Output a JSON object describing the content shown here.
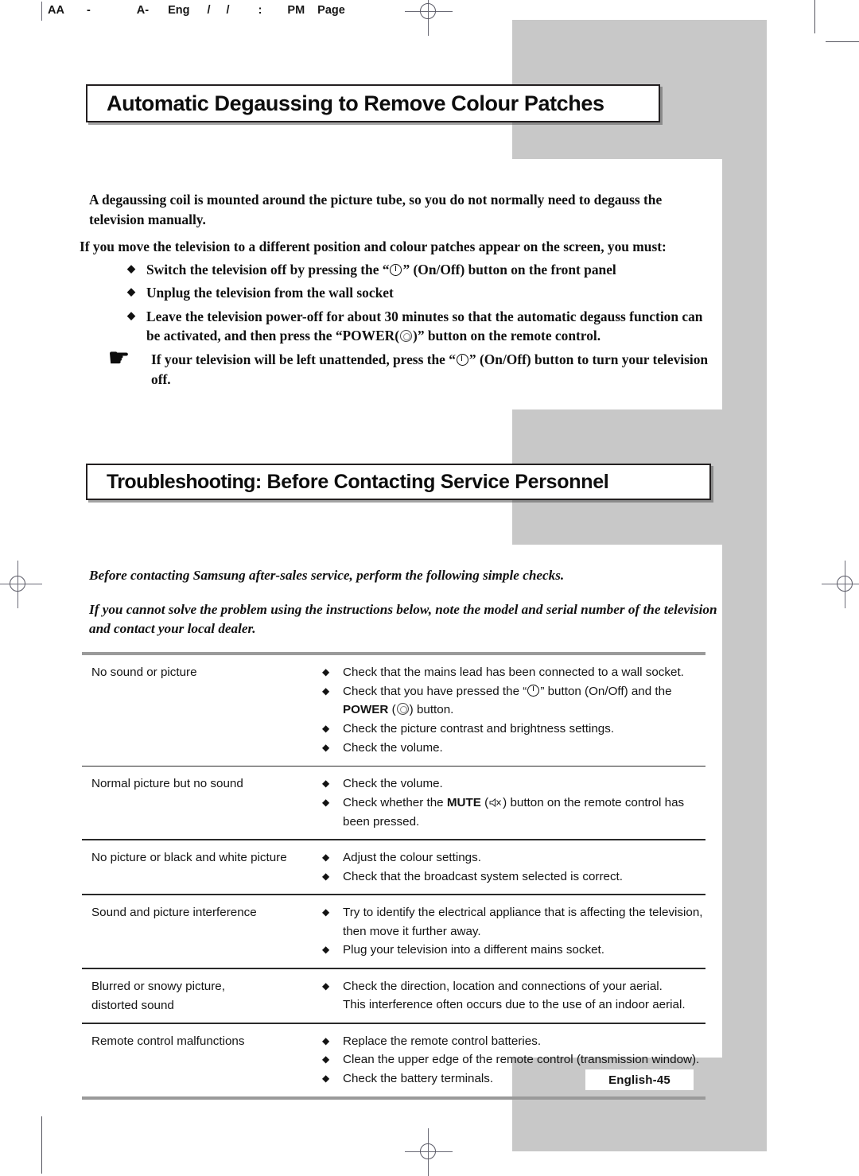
{
  "slug": {
    "segments": [
      "AA",
      "-",
      "A-",
      "Eng",
      "/",
      "/",
      ":",
      "PM",
      "Page"
    ]
  },
  "section_one": {
    "title": "Automatic Degaussing to Remove Colour Patches",
    "intro_paragraph": "A degaussing coil is mounted around the picture tube, so you do not normally need to degauss the television manually.",
    "lead_in": "If you move the television to a different position and colour patches appear on the screen, you must:",
    "bullet_glyph": "◆",
    "bullets": [
      {
        "pre": "Switch the television off by pressing the “",
        "icon": "power-onoff-icon",
        "post": "” (On/Off) button on the front panel"
      },
      {
        "pre": "Unplug the television from the wall socket",
        "icon": "",
        "post": ""
      },
      {
        "pre": "Leave the television power-off for about 30 minutes so that the automatic degauss function can be activated, and then press the “POWER(",
        "icon": "power-ring-icon",
        "post": ")” button on the remote control."
      }
    ],
    "note": {
      "icon": "pointing-hand-icon",
      "glyph": "☛",
      "pre": "If your television will be left unattended, press the “",
      "inline_icon": "power-onoff-icon",
      "post": "” (On/Off) button to turn your television off."
    }
  },
  "section_two": {
    "title_strong": "Troubleshooting:",
    "title_rest": "Before Contacting Service Personnel",
    "intro_italic_1": "Before contacting Samsung after-sales service, perform the following simple checks.",
    "intro_italic_2": "If you cannot solve the problem using the instructions below, note the model and serial number of the television and contact your local dealer.",
    "bullet_glyph": "◆",
    "rows": [
      {
        "cause": [
          "No sound or picture"
        ],
        "fixes": [
          {
            "text": "Check that the mains lead has been connected to a wall socket.",
            "lines": []
          },
          {
            "text": "Check that you have pressed the “",
            "icon_mid": "power-onoff-icon",
            "text2": "” button (On/Off) and the",
            "lines": [
              "POWER ( ) button."
            ],
            "second_line_bold_word": "POWER",
            "second_line_icon": "power-ring-icon",
            "second_line_tail": ") button."
          },
          {
            "text": "Check the picture contrast and brightness settings.",
            "lines": []
          },
          {
            "text": "Check the volume.",
            "lines": []
          }
        ]
      },
      {
        "cause": [
          "Normal picture but no sound"
        ],
        "fixes": [
          {
            "text": "Check the volume.",
            "lines": []
          },
          {
            "text": "Check whether the ",
            "bold_word": "MUTE",
            "icon_mid": "mute-icon",
            "text2": ") button on the remote control has",
            "lines": [
              "been pressed."
            ]
          }
        ]
      },
      {
        "cause": [
          "No picture or black and white picture"
        ],
        "fixes": [
          {
            "text": "Adjust the colour settings.",
            "lines": []
          },
          {
            "text": "Check that the broadcast system selected is correct.",
            "lines": []
          }
        ]
      },
      {
        "cause": [
          "Sound and picture interference"
        ],
        "fixes": [
          {
            "text": "Try to identify the electrical appliance that is affecting the television,",
            "lines": [
              "then move it further away."
            ]
          },
          {
            "text": "Plug your television into a different mains socket.",
            "lines": []
          }
        ]
      },
      {
        "cause": [
          "Blurred or snowy picture,",
          "distorted sound"
        ],
        "fixes": [
          {
            "text": "Check the direction, location and connections of your aerial.",
            "lines": [
              "This interference often occurs due to the use of an indoor aerial."
            ]
          }
        ]
      },
      {
        "cause": [
          "Remote control malfunctions"
        ],
        "fixes": [
          {
            "text": "Replace the remote control batteries.",
            "lines": []
          },
          {
            "text": "Clean the upper edge of the remote control (transmission window).",
            "lines": []
          },
          {
            "text": "Check the battery terminals.",
            "lines": []
          }
        ]
      }
    ]
  },
  "footer": {
    "page_label": "English-45"
  },
  "colors": {
    "gray_block": "#c8c8c8",
    "rule_dark": "#2a2a2a",
    "rule_gray": "#9a9a9a",
    "text": "#111111",
    "crop_mark": "#6a6a76"
  }
}
